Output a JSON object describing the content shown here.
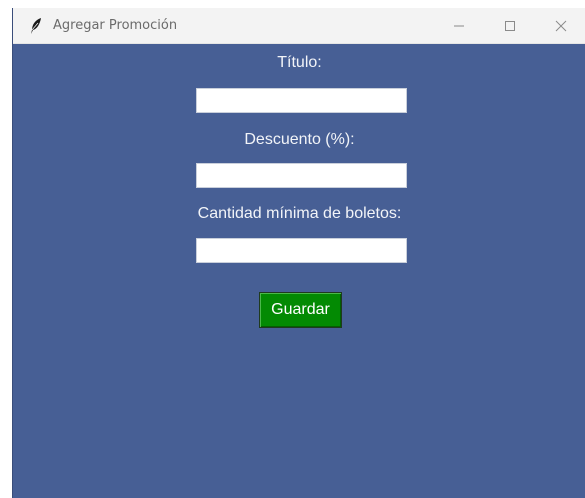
{
  "window": {
    "title": "Agregar Promoción",
    "controls": {
      "minimize": "—",
      "maximize": "☐",
      "close": "✕"
    }
  },
  "form": {
    "title_label": "Título:",
    "discount_label": "Descuento (%):",
    "min_tickets_label": "Cantidad mínima de boletos:",
    "title_value": "",
    "discount_value": "",
    "min_tickets_value": "",
    "save_label": "Guardar"
  },
  "colors": {
    "background": "#475f95",
    "save_button": "#038a03"
  }
}
